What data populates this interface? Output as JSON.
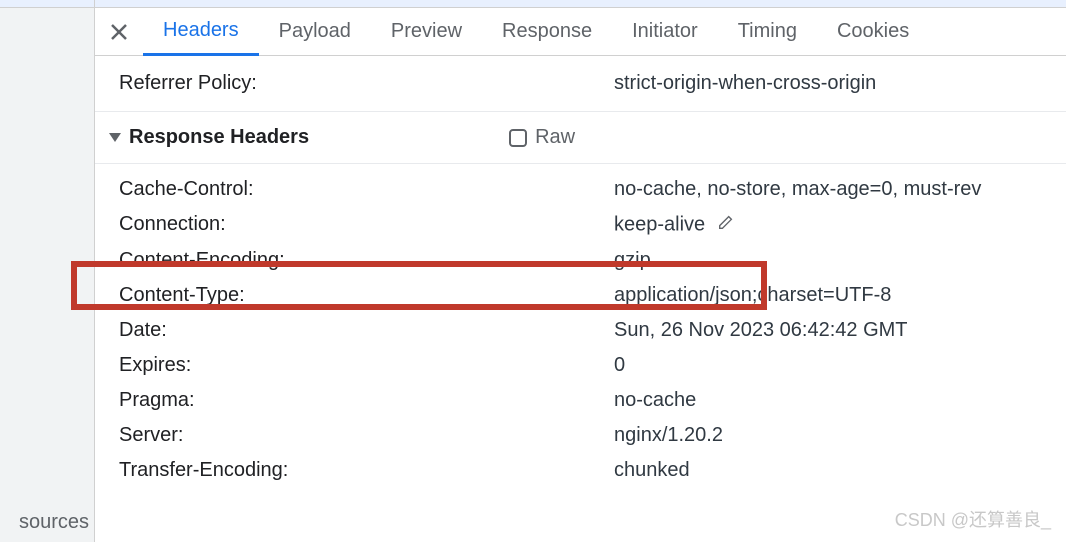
{
  "left": {
    "bottom_label": "sources"
  },
  "tabs": {
    "items": [
      {
        "label": "Headers",
        "active": true
      },
      {
        "label": "Payload",
        "active": false
      },
      {
        "label": "Preview",
        "active": false
      },
      {
        "label": "Response",
        "active": false
      },
      {
        "label": "Initiator",
        "active": false
      },
      {
        "label": "Timing",
        "active": false
      },
      {
        "label": "Cookies",
        "active": false
      }
    ]
  },
  "referrer": {
    "key": "Referrer Policy:",
    "value": "strict-origin-when-cross-origin"
  },
  "section": {
    "title": "Response Headers",
    "raw_label": "Raw"
  },
  "headers": [
    {
      "key": "Cache-Control:",
      "value": "no-cache, no-store, max-age=0, must-rev",
      "editable": false
    },
    {
      "key": "Connection:",
      "value": "keep-alive",
      "editable": true
    },
    {
      "key": "Content-Encoding:",
      "value": "gzip",
      "editable": false
    },
    {
      "key": "Content-Type:",
      "value": "application/json;charset=UTF-8",
      "editable": false
    },
    {
      "key": "Date:",
      "value": "Sun, 26 Nov 2023 06:42:42 GMT",
      "editable": false
    },
    {
      "key": "Expires:",
      "value": "0",
      "editable": false
    },
    {
      "key": "Pragma:",
      "value": "no-cache",
      "editable": false
    },
    {
      "key": "Server:",
      "value": "nginx/1.20.2",
      "editable": false
    },
    {
      "key": "Transfer-Encoding:",
      "value": "chunked",
      "editable": false
    }
  ],
  "watermark": "CSDN @还算善良_"
}
